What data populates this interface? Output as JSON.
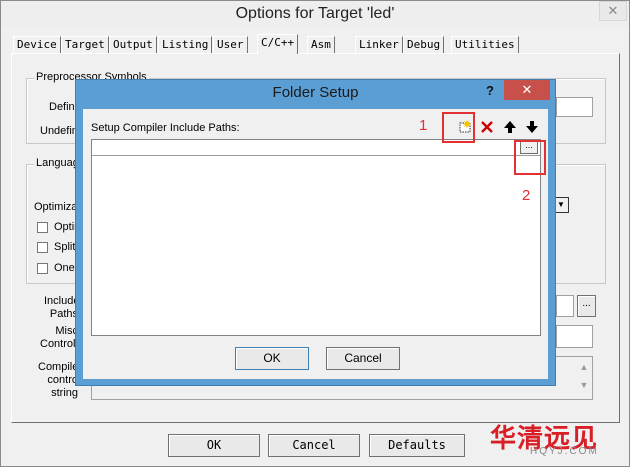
{
  "window": {
    "title": "Options for Target 'led'",
    "close_glyph": "✕"
  },
  "tabs": [
    {
      "label": "Device"
    },
    {
      "label": "Target"
    },
    {
      "label": "Output"
    },
    {
      "label": "Listing"
    },
    {
      "label": "User"
    },
    {
      "label": "C/C++",
      "active": true
    },
    {
      "label": "Asm"
    },
    {
      "label": "Linker"
    },
    {
      "label": "Debug"
    },
    {
      "label": "Utilities"
    }
  ],
  "background_panel": {
    "preprocessor_group": "Preprocessor Symbols",
    "define_label": "Defin",
    "undefine_label": "Undefin",
    "language_group": "Languag",
    "optimization_label": "Optimizat",
    "options": [
      "Optin",
      "Split",
      "One"
    ],
    "include_paths_label": [
      "Include",
      "Paths"
    ],
    "misc_controls_label": [
      "Misc",
      "Controls"
    ],
    "compiler_control_label": [
      "Compile",
      "contro",
      "string"
    ],
    "browse_glyph": "..."
  },
  "bottom_buttons": {
    "ok": "OK",
    "cancel": "Cancel",
    "defaults": "Defaults"
  },
  "dialog": {
    "title": "Folder Setup",
    "help_glyph": "?",
    "close_glyph": "✕",
    "paths_label": "Setup Compiler Include Paths:",
    "browse_glyph": "...",
    "ok": "OK",
    "cancel": "Cancel"
  },
  "annotations": {
    "marker_1": "1",
    "marker_2": "2"
  },
  "watermark": {
    "text": "华清远见",
    "subtext": "HQYJ.COM"
  },
  "colors": {
    "dialog_frame": "#5b9ed3",
    "close_red": "#c7514a",
    "annotation_red": "#e33030"
  }
}
